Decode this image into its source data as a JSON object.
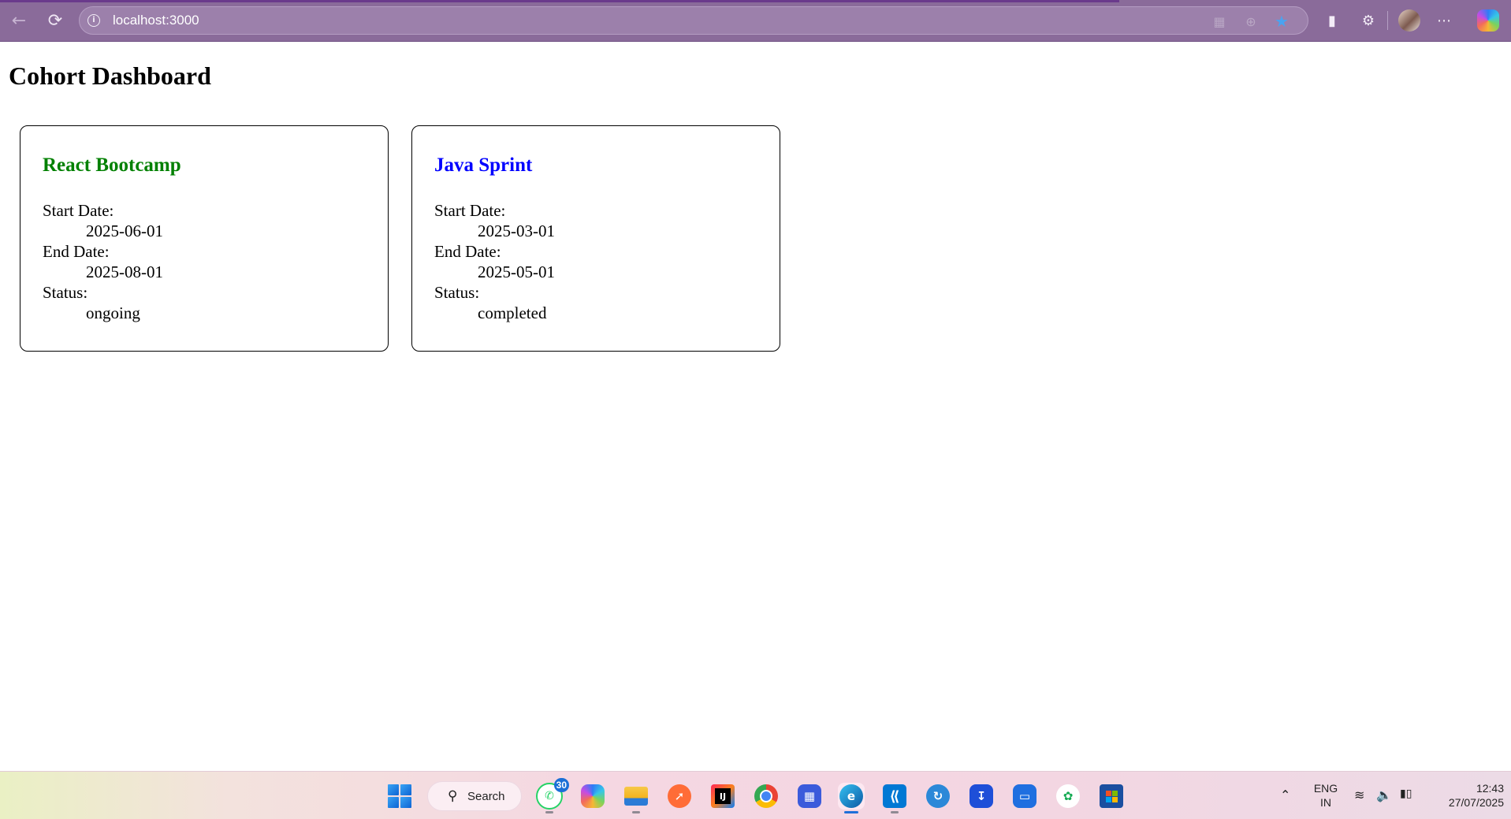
{
  "browser": {
    "url": "localhost:3000",
    "back_icon": "arrow-left-icon",
    "reload_icon": "reload-icon"
  },
  "page": {
    "title": "Cohort Dashboard"
  },
  "cohorts": [
    {
      "name": "React Bootcamp",
      "name_color": "#008000",
      "start_label": "Start Date:",
      "start_date": "2025-06-01",
      "end_label": "End Date:",
      "end_date": "2025-08-01",
      "status_label": "Status:",
      "status": "ongoing"
    },
    {
      "name": "Java Sprint",
      "name_color": "#0000ff",
      "start_label": "Start Date:",
      "start_date": "2025-03-01",
      "end_label": "End Date:",
      "end_date": "2025-05-01",
      "status_label": "Status:",
      "status": "completed"
    }
  ],
  "taskbar": {
    "search_label": "Search",
    "whatsapp_badge": "30",
    "language_line1": "ENG",
    "language_line2": "IN",
    "time": "12:43",
    "date": "27/07/2025"
  }
}
